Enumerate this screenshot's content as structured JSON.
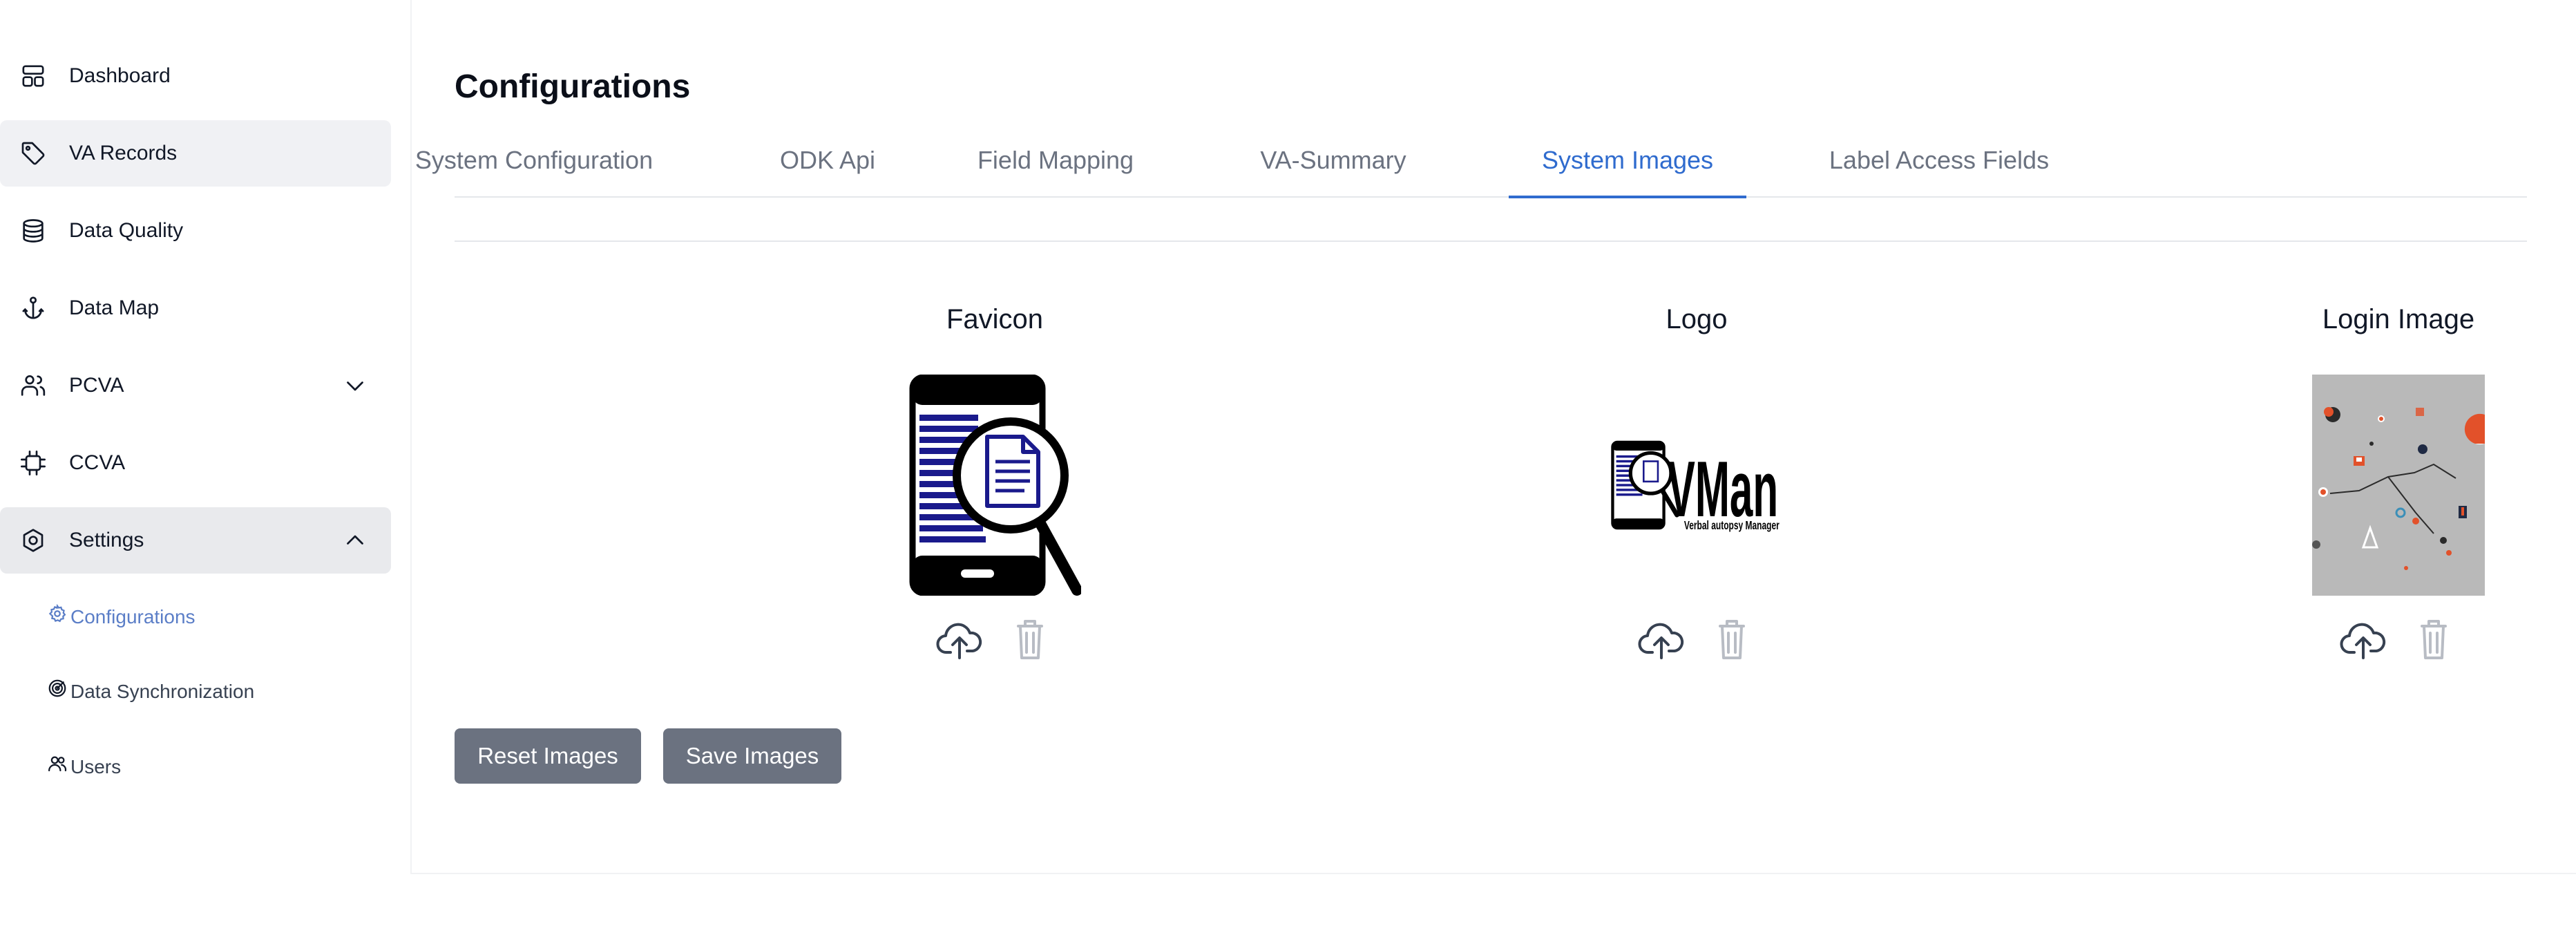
{
  "sidebar": {
    "items": [
      {
        "label": "Dashboard",
        "icon": "dashboard-icon"
      },
      {
        "label": "VA Records",
        "icon": "tag-icon"
      },
      {
        "label": "Data Quality",
        "icon": "database-icon"
      },
      {
        "label": "Data Map",
        "icon": "anchor-icon"
      },
      {
        "label": "PCVA",
        "icon": "users-icon",
        "chevron": "chevron-down-icon"
      },
      {
        "label": "CCVA",
        "icon": "cpu-icon"
      },
      {
        "label": "Settings",
        "icon": "settings-icon",
        "chevron": "chevron-up-icon"
      }
    ],
    "settings_children": [
      {
        "label": "Configurations",
        "icon": "gear-icon"
      },
      {
        "label": "Data Synchronization",
        "icon": "sync-icon"
      },
      {
        "label": "Users",
        "icon": "user-group-icon"
      }
    ]
  },
  "main": {
    "title": "Configurations",
    "tabs": [
      {
        "label": "System Configuration"
      },
      {
        "label": "ODK Api"
      },
      {
        "label": "Field Mapping"
      },
      {
        "label": "VA-Summary"
      },
      {
        "label": "System Images"
      },
      {
        "label": "Label Access Fields"
      }
    ],
    "active_tab": "System Images",
    "images": [
      {
        "title": "Favicon"
      },
      {
        "title": "Logo",
        "logo_text": "VMan",
        "logo_subtext": "Verbal autopsy Manager"
      },
      {
        "title": "Login Image"
      }
    ],
    "buttons": {
      "reset": "Reset Images",
      "save": "Save Images"
    }
  },
  "colors": {
    "accent": "#2f6bce",
    "button_bg": "#6b7280",
    "sidebar_active": "#f0f1f4",
    "link_active": "#5b7ec7"
  }
}
